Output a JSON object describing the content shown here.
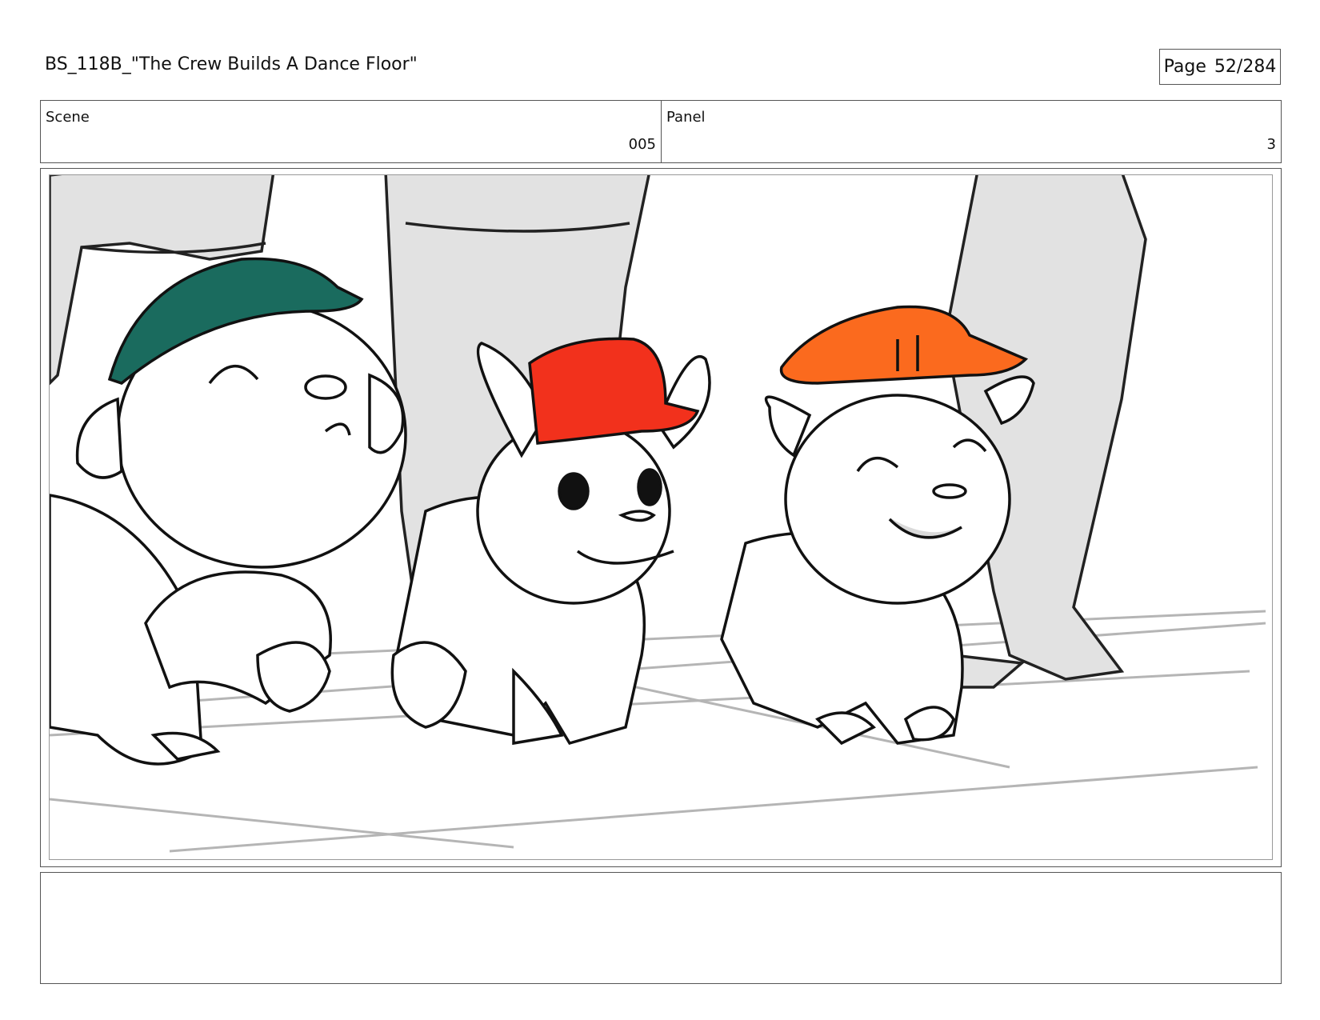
{
  "header": {
    "title": "BS_118B_\"The Crew Builds A Dance Floor\"",
    "page_label": "Page",
    "page_number": "52/284"
  },
  "info": {
    "scene_label": "Scene",
    "scene_value": "005",
    "panel_label": "Panel",
    "panel_value": "3"
  },
  "colors": {
    "teal_cap": "#1a6b5e",
    "red_cap": "#f2311c",
    "orange_cap": "#fb6a1e",
    "leg_gray": "#e2e2e2"
  },
  "notes": {
    "text": ""
  }
}
